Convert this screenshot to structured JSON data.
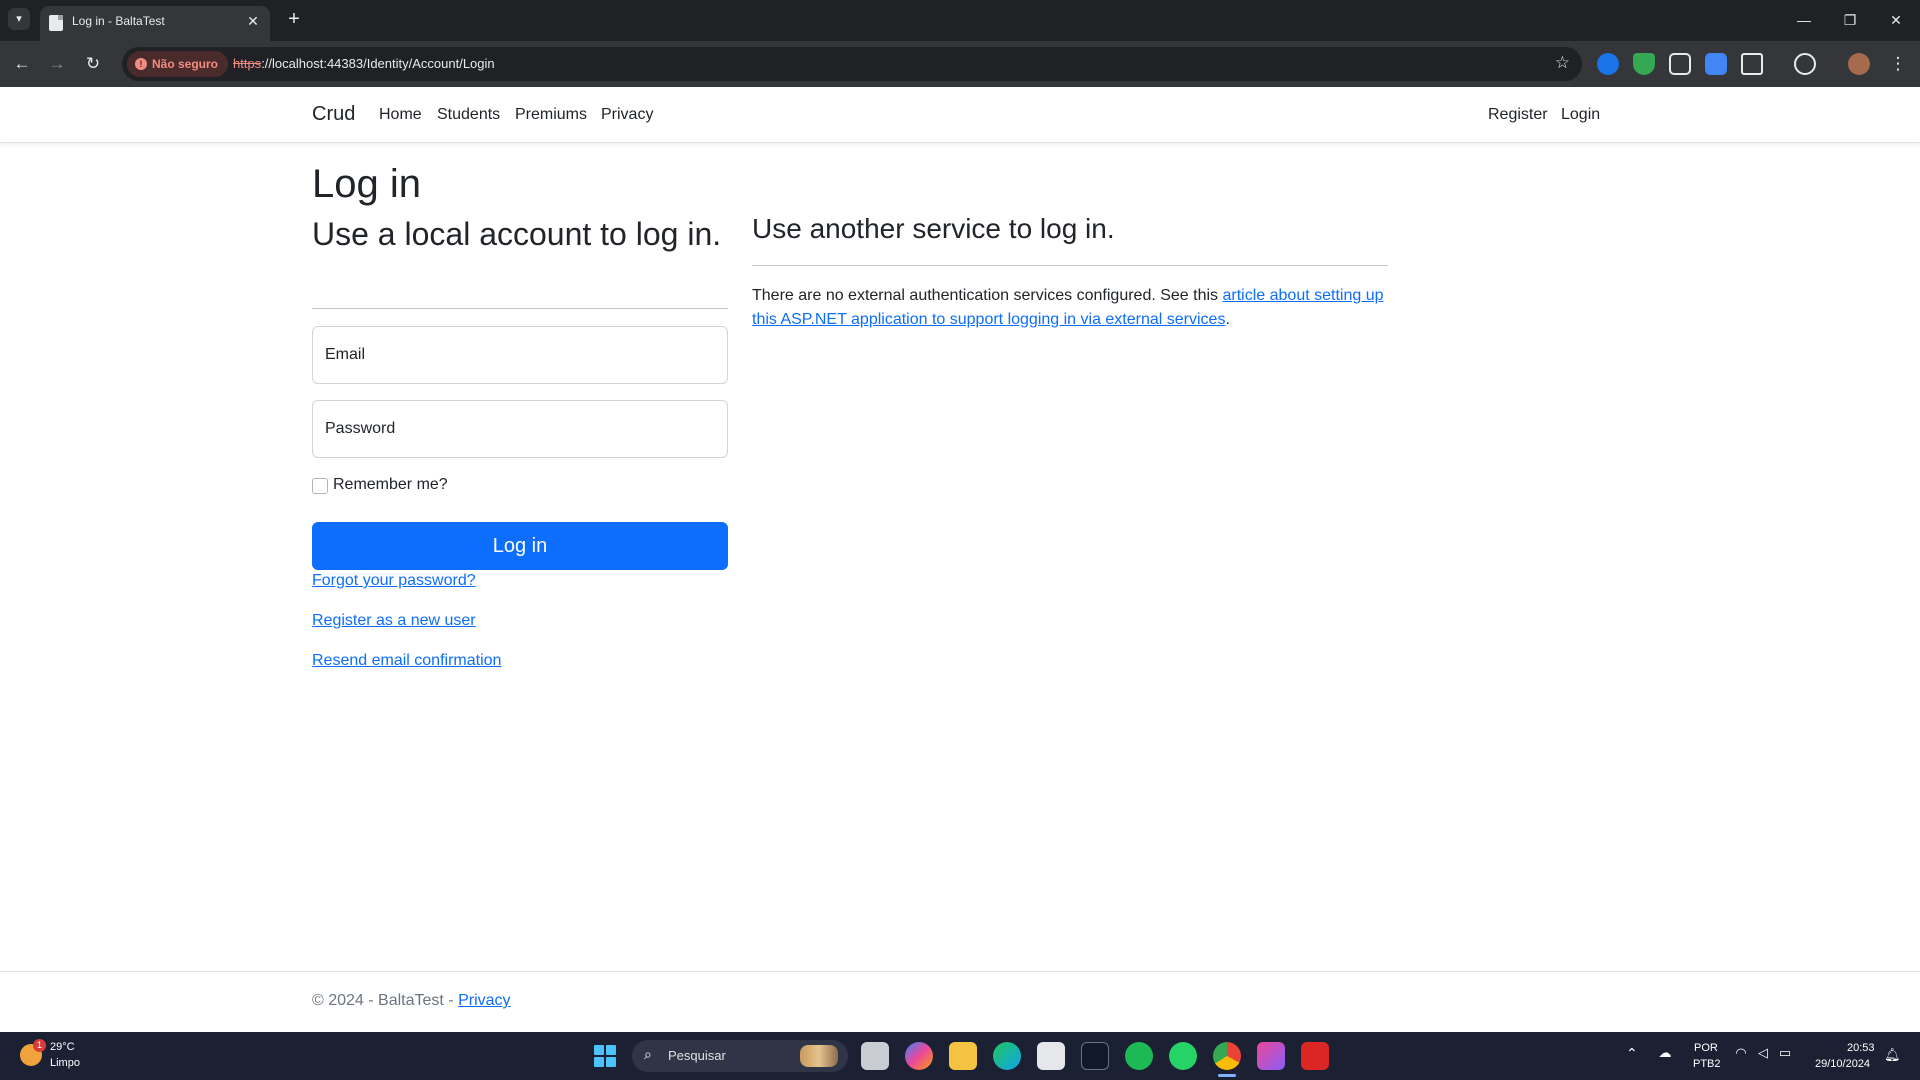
{
  "browser": {
    "tab_title": "Log in - BaltaTest",
    "security_label": "Não seguro",
    "url_scheme": "https",
    "url_rest": "://localhost:44383/Identity/Account/Login"
  },
  "navbar": {
    "brand": "Crud",
    "links": [
      "Home",
      "Students",
      "Premiums",
      "Privacy"
    ],
    "register": "Register",
    "login": "Login"
  },
  "main": {
    "title": "Log in",
    "local_heading": "Use a local account to log in.",
    "email_placeholder": "Email",
    "password_placeholder": "Password",
    "remember_label": "Remember me?",
    "login_button": "Log in",
    "forgot_link": "Forgot your password?",
    "register_link": "Register as a new user",
    "resend_link": "Resend email confirmation",
    "external_heading": "Use another service to log in.",
    "external_text_before": "There are no external authentication services configured. See this ",
    "external_link": "article about setting up this ASP.NET application to support logging in via external services",
    "external_text_after": "."
  },
  "footer": {
    "text": "© 2024 - BaltaTest - ",
    "privacy_link": "Privacy"
  },
  "taskbar": {
    "weather_temp": "29°C",
    "weather_condition": "Limpo",
    "weather_badge": "1",
    "search_placeholder": "Pesquisar",
    "lang_line1": "POR",
    "lang_line2": "PTB2",
    "time": "20:53",
    "date": "29/10/2024"
  },
  "colors": {
    "primary": "#0d6efd",
    "chrome_dark": "#202124",
    "taskbar": "#1b2133"
  }
}
